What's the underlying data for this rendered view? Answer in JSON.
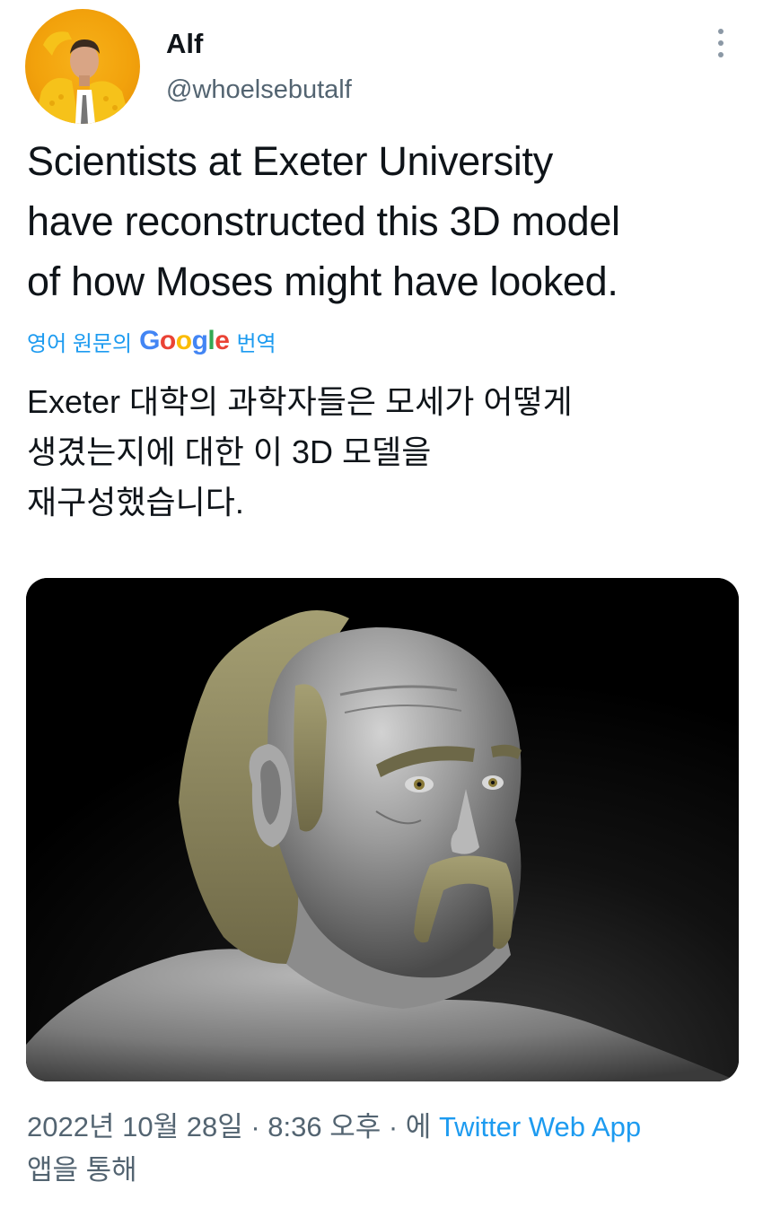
{
  "author": {
    "display_name": "Alf",
    "handle": "@whoelsebutalf",
    "avatar_icon": "profile-photo"
  },
  "more_icon": "more-vertical-icon",
  "tweet": {
    "lines": [
      "Scientists at Exeter University",
      "have reconstructed this 3D model",
      "of how Moses might have looked."
    ]
  },
  "translation": {
    "prefix": "영어 원문의",
    "google": [
      "G",
      "o",
      "o",
      "g",
      "l",
      "e"
    ],
    "suffix": "번역",
    "lines": [
      "Exeter 대학의 과학자들은 모세가 어떻게",
      "생겼는지에 대한 이 3D 모델을",
      "재구성했습니다."
    ]
  },
  "media": {
    "kind": "3d-sculpt-render",
    "background": "#000000",
    "skin_color": "#8a8a8a",
    "hair_color": "#8c8560"
  },
  "meta": {
    "timestamp": "2022년 10월 28일 · 8:36 오후 · 에",
    "source": "Twitter Web App",
    "suffix": "앱을 통해"
  },
  "colors": {
    "link": "#1d9bf0",
    "secondary": "#536471",
    "primary": "#0f1419",
    "avatar_bg": "#f2a20c"
  }
}
